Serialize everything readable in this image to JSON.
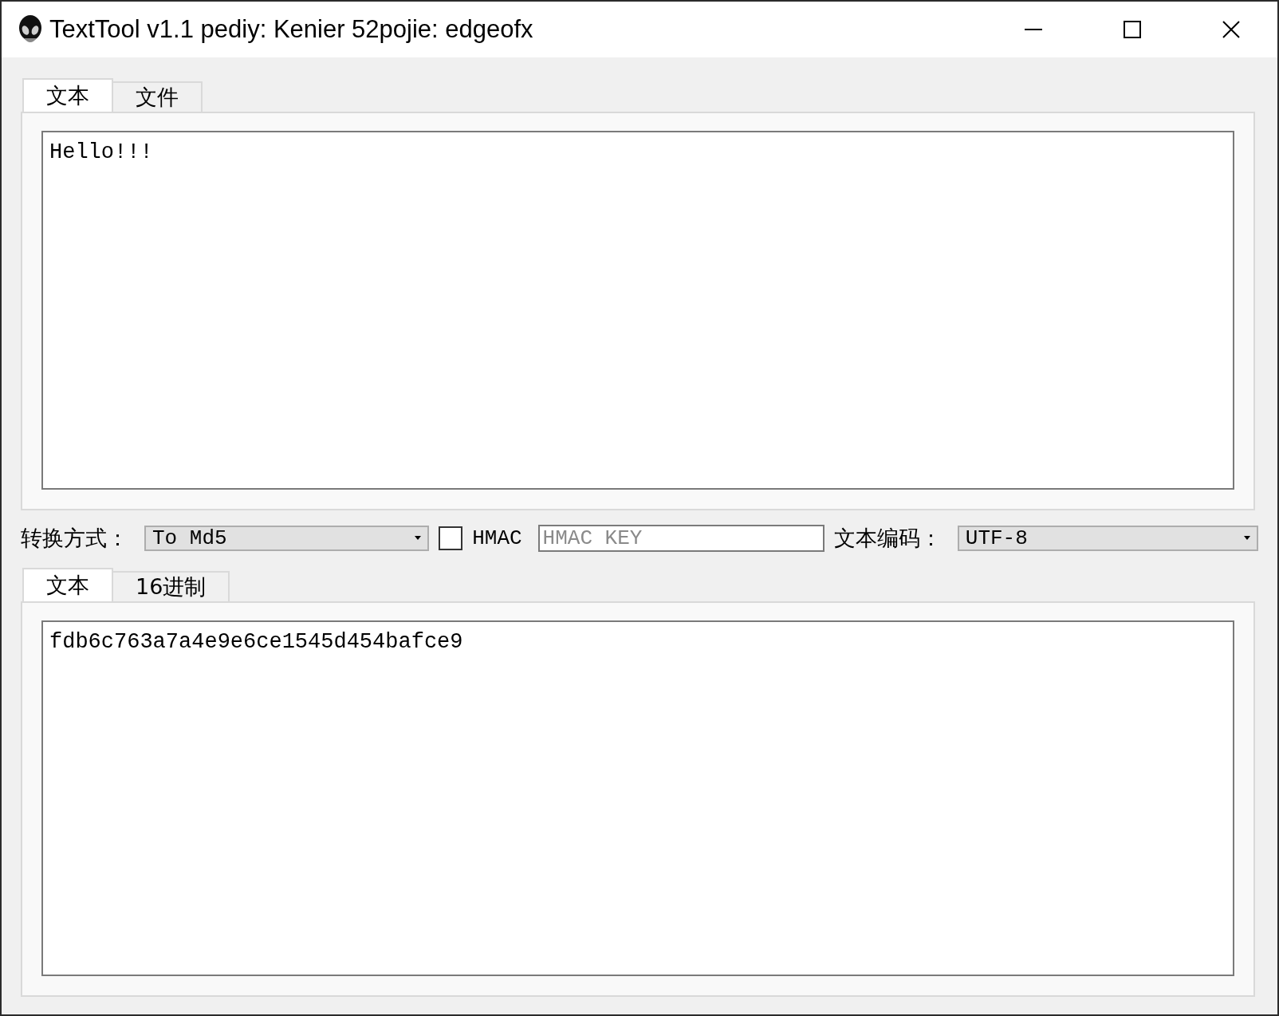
{
  "window": {
    "title": "TextTool v1.1 pediy: Kenier 52pojie: edgeofx"
  },
  "input_tabs": [
    {
      "label": "文本",
      "selected": true
    },
    {
      "label": "文件",
      "selected": false
    }
  ],
  "input_text": {
    "value": "Hello!!!"
  },
  "controls": {
    "mode_label": "转换方式：",
    "mode_value": "To Md5",
    "hmac": {
      "label": "HMAC",
      "checked": false
    },
    "hmac_key": {
      "placeholder": "HMAC KEY"
    },
    "encoding_label": "文本编码：",
    "encoding_value": "UTF-8"
  },
  "output_tabs": [
    {
      "label": "文本",
      "selected": true
    },
    {
      "label": "16进制",
      "selected": false
    }
  ],
  "output_text": {
    "value": "fdb6c763a7a4e9e6ce1545d454bafce9"
  }
}
